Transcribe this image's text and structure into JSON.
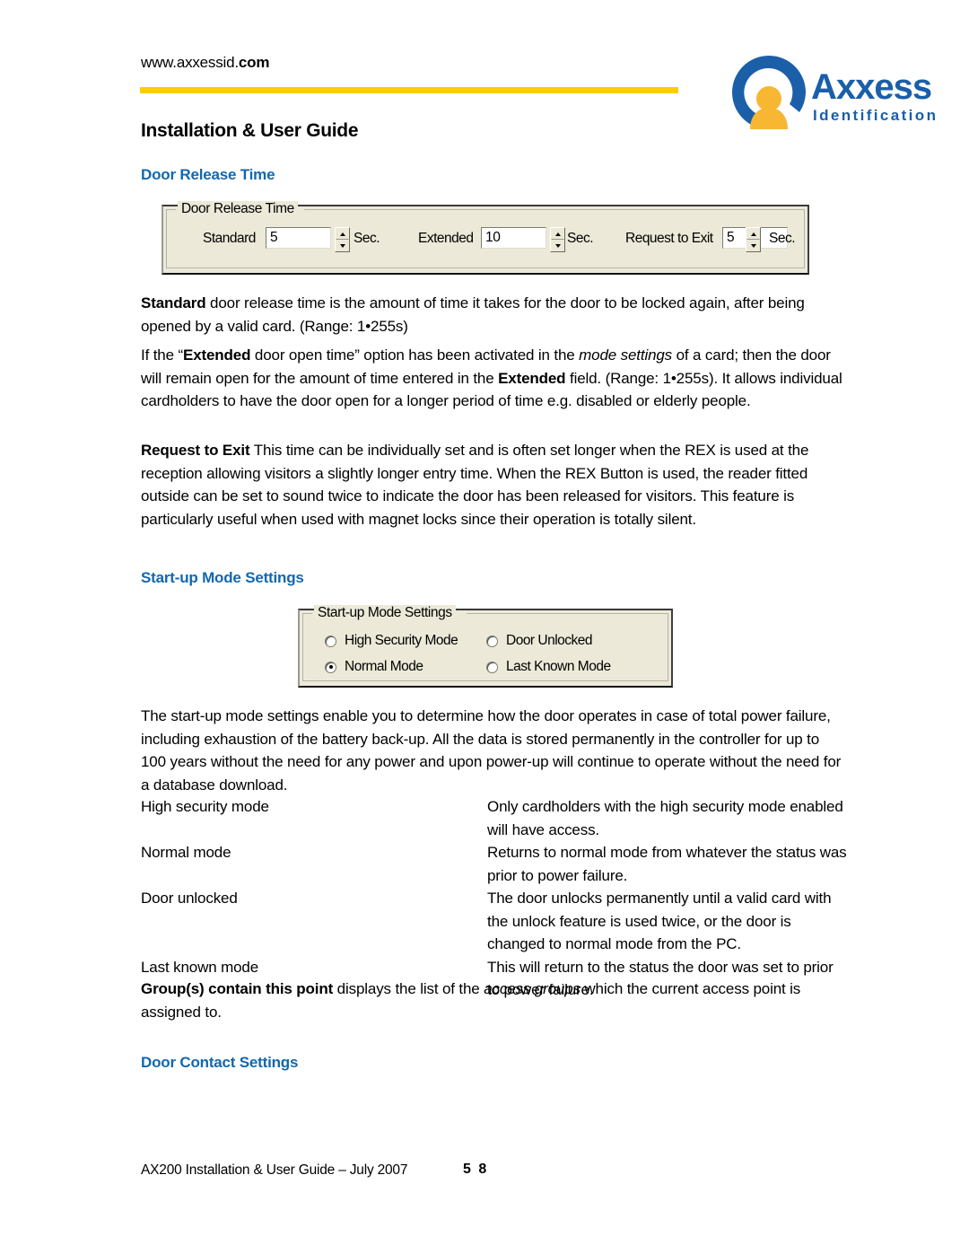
{
  "header": {
    "site_url_prefix": "www.axxessid.",
    "site_url_suffix": "com",
    "doc_title": "Installation & User Guide",
    "logo_word": "Axxess",
    "logo_tagline": "Identification",
    "rule_color": "#FFCC00",
    "brand_blue": "#1A5FA8",
    "brand_orange": "#F7B733"
  },
  "headings": {
    "door_release_time": "Door Release Time",
    "startup_mode_settings": "Start-up Mode Settings",
    "door_contact_settings": "Door Contact Settings",
    "heading_color": "#1268AE"
  },
  "door_release_dialog": {
    "legend": "Door Release Time",
    "fields": [
      {
        "label": "Standard",
        "value": "5",
        "unit": "Sec."
      },
      {
        "label": "Extended",
        "value": "10",
        "unit": "Sec."
      },
      {
        "label": "Request to Exit",
        "value": "5",
        "unit": "Sec."
      }
    ],
    "background_color": "#ECE9D8"
  },
  "startup_dialog": {
    "legend": "Start-up Mode Settings",
    "options": [
      {
        "label": "High Security Mode",
        "selected": false
      },
      {
        "label": "Door Unlocked",
        "selected": false
      },
      {
        "label": "Normal Mode",
        "selected": true
      },
      {
        "label": "Last Known Mode",
        "selected": false
      }
    ],
    "background_color": "#ECE9D8"
  },
  "paragraphs": {
    "standard": "<b>Standard</b> door release time is the amount of time it takes for the door to be locked again, after being opened by a valid card. (Range: 1•255s)",
    "extended": "If the “<b>Extended</b> door open time” option has been activated in the <i>mode settings</i> of a card; then the door will remain open for the amount of time entered in the <b>Extended</b> field. (Range: 1•255s). It allows individual cardholders to have the door open for a longer period of time e.g. disabled or elderly people.",
    "request_to_exit": "<b>Request to Exit</b> This time can be individually set and is often set longer when the REX is used at the reception allowing visitors a slightly longer entry time. When the REX Button is used, the reader fitted outside can be set to sound twice to indicate the door has been released for visitors. This feature is particularly useful when used with magnet locks since their operation is totally silent.",
    "startup": "The start-up mode settings enable you to determine how the door operates in case of total power failure, including exhaustion of the battery back-up. All the data is stored permanently in the controller for up to 100 years without the need for any power and upon power-up will continue to operate without the need for a database download.",
    "groups": "<b>Group(s) contain this point</b> displays the list of the <i>access groups</i> which the current access point is assigned to."
  },
  "mode_definitions": [
    {
      "term": "High security mode",
      "description": "Only cardholders with the high security mode enabled will have access."
    },
    {
      "term": "Normal mode",
      "description": "Returns to normal mode from whatever the status was prior to power failure."
    },
    {
      "term": "Door unlocked",
      "description": "The door unlocks permanently until a valid card with the unlock feature is used twice, or the door is changed to normal mode from the PC."
    },
    {
      "term": "Last known mode",
      "description": "This will return to the status the door was set to prior to power failure."
    }
  ],
  "footer": {
    "text": "AX200 Installation & User Guide – July 2007",
    "page_number": "5 8"
  }
}
